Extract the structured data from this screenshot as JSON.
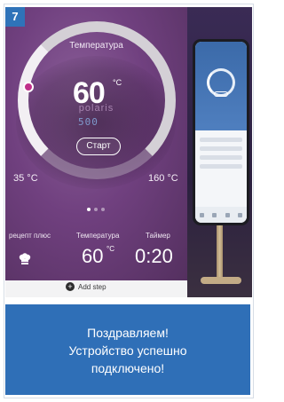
{
  "step_badge": "7",
  "app_screen": {
    "temperature_label": "Температура",
    "temperature_value": "60",
    "temperature_unit": "°C",
    "brand": "polaris",
    "display_readout": "500",
    "start_button": "Старт",
    "range_min": "35 °C",
    "range_max": "160 °C",
    "pager": {
      "count": 3,
      "active_index": 0
    },
    "recipe_label": "рецепт плюс",
    "bottom_temp_label": "Температура",
    "bottom_temp_value": "60",
    "bottom_temp_unit": "°C",
    "timer_label": "Таймер",
    "timer_value": "0:20",
    "add_step_label": "Add step"
  },
  "caption": {
    "lines": [
      "Поздравляем!",
      "Устройство успешно",
      "подключено!"
    ]
  },
  "colors": {
    "badge_bg": "#2f73b9",
    "caption_bg": "#2f6fb7",
    "screen_purple": "#70407f",
    "accent_dot": "#c0308a"
  }
}
